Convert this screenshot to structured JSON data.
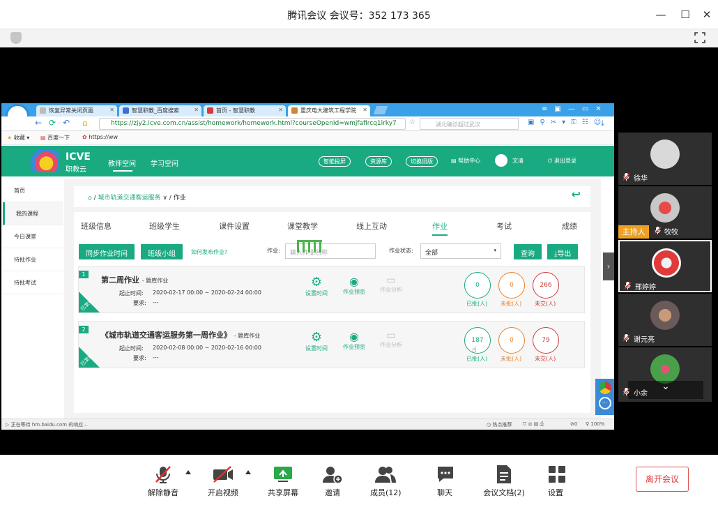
{
  "window": {
    "title": "腾讯会议 会议号：352 173 365"
  },
  "browser": {
    "tabs": [
      {
        "label": "恢复异常关闭页面"
      },
      {
        "label": "智慧职教_百度搜索"
      },
      {
        "label": "首页 - 智慧职教"
      },
      {
        "label": "重庆电大建筑工程学院"
      }
    ],
    "url": "https://zjy2.icve.com.cn/assist/homework/homework.html?courseOpenId=wmjfafircq1lrky7",
    "search_placeholder": "湖北确诊超过武汉",
    "bookmarks": {
      "fav": "收藏",
      "b1": "百度一下",
      "b2": "https://ww"
    },
    "status_left": "正在等待 hm.baidu.com 的响应...",
    "status_right": "热点推荐",
    "zoom": "100%",
    "count": "0"
  },
  "site": {
    "logo_en": "ICVE",
    "logo_cn": "职教云",
    "nav": [
      "教师空间",
      "学习空间"
    ],
    "pills": [
      "智能投屏",
      "资源库",
      "切换旧版"
    ],
    "help": "帮助中心",
    "user": "文清",
    "logout": "退出登录"
  },
  "sidebar": [
    "首页",
    "我的课程",
    "今日课堂",
    "待批作业",
    "待批考试"
  ],
  "breadcrumb": {
    "course": "城市轨道交通客运服务",
    "page": "作业"
  },
  "course_tabs": [
    "班级信息",
    "班级学生",
    "课件设置",
    "课堂教学",
    "线上互动",
    "作业",
    "考试",
    "成绩"
  ],
  "toolbar": {
    "sync": "同步作业时间",
    "group": "班级小组",
    "howto": "如何发布作业?",
    "hw_label": "作业:",
    "hw_placeholder": "输入作业名称",
    "status_label": "作业状态:",
    "status_value": "全部",
    "query": "查询",
    "export": "导出"
  },
  "homeworks": [
    {
      "num": "1",
      "title": "第二周作业",
      "type": "- 题库作业",
      "period_label": "起止时间:",
      "period": "2020-02-17 00:00 ~ 2020-02-24 00:00",
      "req_label": "要求:",
      "req": "---",
      "status": "已发布",
      "actions": [
        "设置时间",
        "作业预览",
        "作业分析"
      ],
      "stats": [
        {
          "v": "0",
          "l": "已批(人)"
        },
        {
          "v": "0",
          "l": "未批(人)"
        },
        {
          "v": "266",
          "l": "未交(人)"
        }
      ]
    },
    {
      "num": "2",
      "title": "《城市轨道交通客运服务第一周作业》",
      "type": "- 题库作业",
      "period_label": "起止时间:",
      "period": "2020-02-08 00:00 ~ 2020-02-16 00:00",
      "req_label": "要求:",
      "req": "---",
      "status": "已发布",
      "actions": [
        "设置时间",
        "作业预览",
        "作业分析"
      ],
      "stats": [
        {
          "v": "187",
          "l": "已批(人)"
        },
        {
          "v": "0",
          "l": "未批(人)"
        },
        {
          "v": "79",
          "l": "未交(人)"
        }
      ]
    }
  ],
  "participants": [
    {
      "name": "徐华"
    },
    {
      "name": "牧牧",
      "badge": "主持人"
    },
    {
      "name": "邢婷婷"
    },
    {
      "name": "谢元亮"
    },
    {
      "name": "小余"
    }
  ],
  "meeting_toolbar": [
    "解除静音",
    "开启视频",
    "共享屏幕",
    "邀请",
    "成员(12)",
    "聊天",
    "会议文档(2)",
    "设置"
  ],
  "leave": "离开会议",
  "colors": {
    "green": "#1aaa82",
    "orange": "#e8822a",
    "red": "#d03a3a",
    "blue": "#3aa0e8"
  }
}
